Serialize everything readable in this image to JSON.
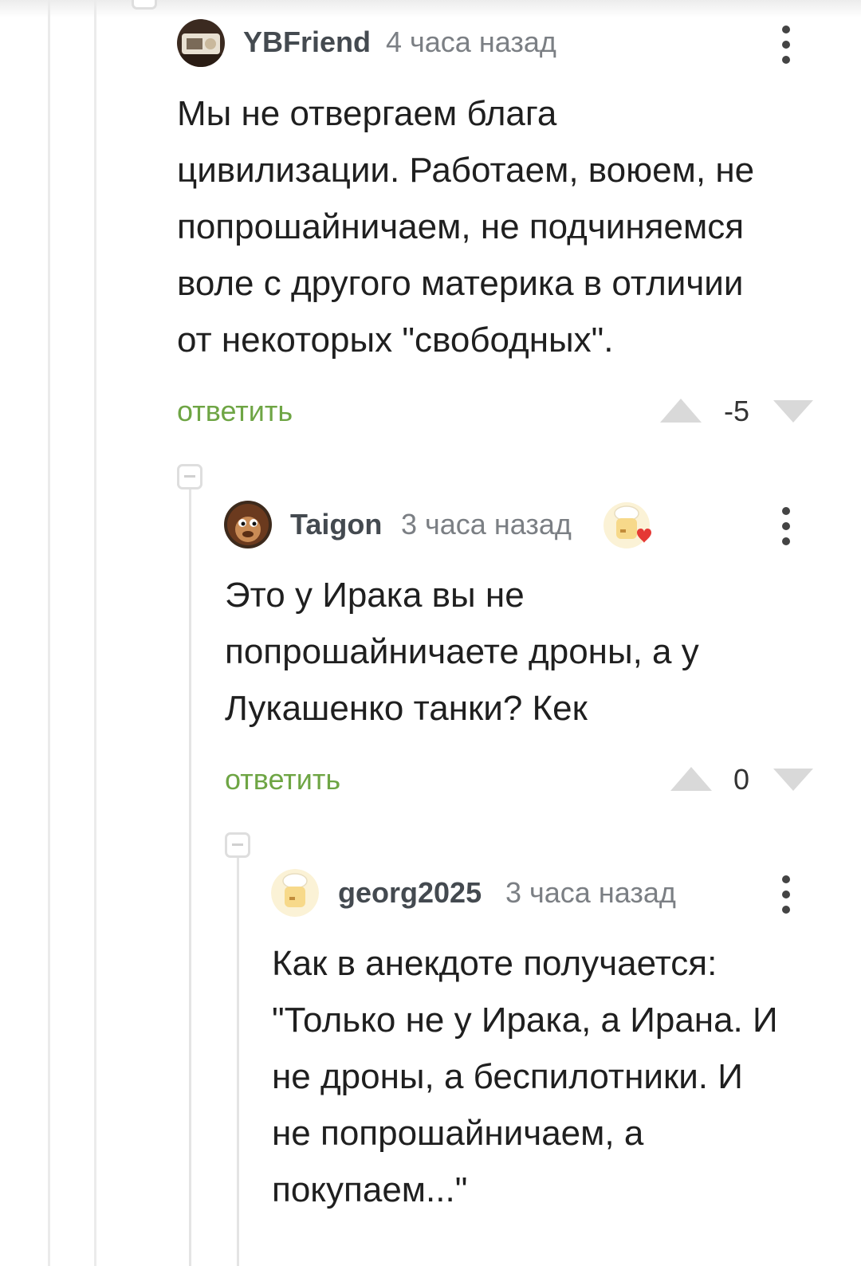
{
  "comments": [
    {
      "username": "YBFriend",
      "time": "4 часа назад",
      "text_lines": [
        "Мы не отвергаем блага",
        "цивилизации. Работаем, воюем, не",
        "попрошайничаем, не подчиняемся",
        "воле с другого материка в отличии",
        "от некоторых \"свободных\"."
      ],
      "reply_label": "ответить",
      "score": "-5"
    },
    {
      "username": "Taigon",
      "time": "3 часа назад",
      "text_lines": [
        "Это у Ирака вы не",
        "попрошайничаете дроны, а у",
        "Лукашенко танки? Кек"
      ],
      "reply_label": "ответить",
      "score": "0"
    },
    {
      "username": "georg2025",
      "time": "3 часа назад",
      "text_lines": [
        "Как в анекдоте получается:",
        "\"Только не у Ирака, а Ирана. И",
        "не дроны, а беспилотники. И",
        "не попрошайничаем, а",
        "покупаем...\""
      ]
    }
  ],
  "colors": {
    "reply_link": "#6ea544",
    "vote_arrow": "#d9d9d9",
    "thread_line": "#e4e4e4"
  },
  "icons": {
    "menu": "kebab-menu-icon",
    "vote_up": "arrow-up-icon",
    "vote_down": "arrow-down-icon",
    "collapse": "collapse-minus-icon",
    "badge": "chef-heart-badge-icon"
  }
}
